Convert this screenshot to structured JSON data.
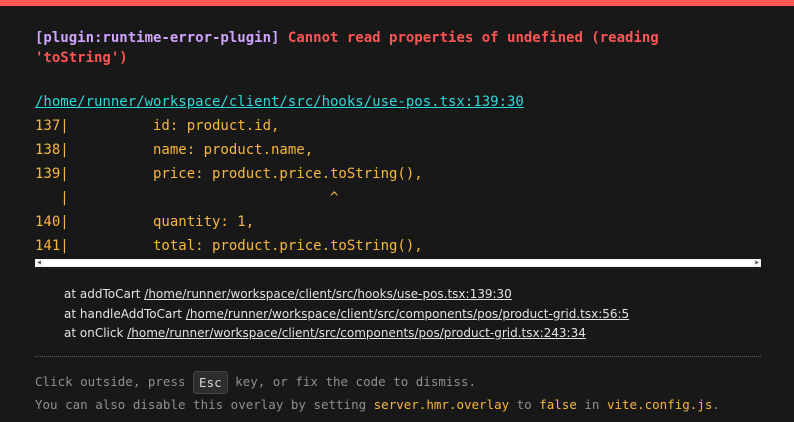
{
  "error": {
    "plugin": "[plugin:runtime-error-plugin]",
    "message": "Cannot read properties of undefined (reading 'toString')"
  },
  "file": {
    "link": "/home/runner/workspace/client/src/hooks/use-pos.tsx:139:30"
  },
  "frame": {
    "lines": [
      "137|          id: product.id,",
      "138|          name: product.name,",
      "139|          price: product.price.toString(),",
      "   |                               ^",
      "140|          quantity: 1,",
      "141|          total: product.price.toString(),"
    ]
  },
  "stack": [
    {
      "prefix": "at addToCart ",
      "file": "/home/runner/workspace/client/src/hooks/use-pos.tsx:139:30"
    },
    {
      "prefix": "at handleAddToCart ",
      "file": "/home/runner/workspace/client/src/components/pos/product-grid.tsx:56:5"
    },
    {
      "prefix": "at onClick ",
      "file": "/home/runner/workspace/client/src/components/pos/product-grid.tsx:243:34"
    }
  ],
  "tip": {
    "line1_before": "Click outside, press ",
    "key": "Esc",
    "line1_after": " key, or fix the code to dismiss.",
    "line2_before": "You can also disable this overlay by setting ",
    "setting": "server.hmr.overlay",
    "line2_mid": " to ",
    "value": "false",
    "line2_in": " in ",
    "config": "vite.config.js",
    "line2_end": "."
  },
  "colors": {
    "accent_border": "#ff5555",
    "plugin_text": "#cfa5ff",
    "error_text": "#ff5555",
    "link": "#2dd9da",
    "code": "#f8b73f",
    "background": "#181818"
  }
}
